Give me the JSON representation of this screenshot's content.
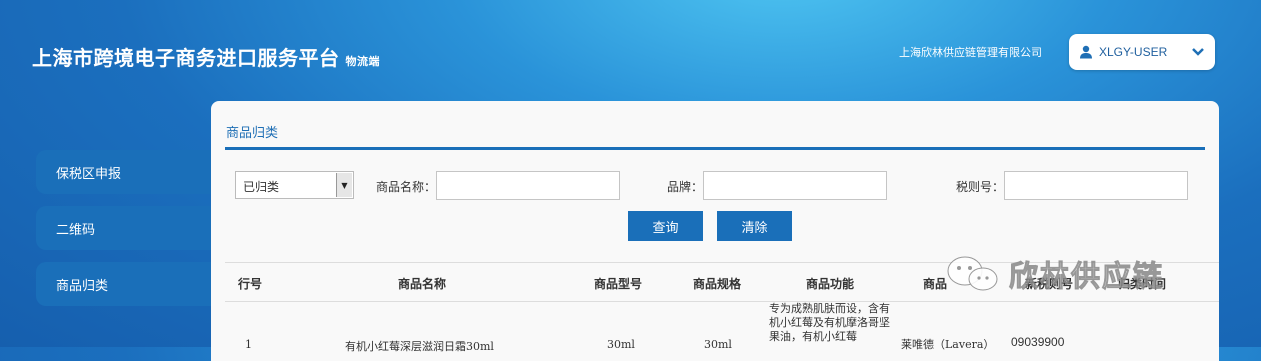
{
  "header": {
    "title": "上海市跨境电子商务进口服务平台",
    "subtitle": "物流端",
    "company": "上海欣林供应链管理有限公司",
    "user": "XLGY-USER",
    "user_icon": "user-icon",
    "dropdown_icon": "chevron-down-icon"
  },
  "sidebar": {
    "items": [
      {
        "label": "保税区申报"
      },
      {
        "label": "二维码"
      },
      {
        "label": "商品归类"
      }
    ]
  },
  "panel": {
    "title": "商品归类",
    "filter": {
      "status_value": "已归类",
      "name_label": "商品名称：",
      "brand_label": "品牌：",
      "tax_label": "税则号：",
      "name_value": "",
      "brand_value": "",
      "tax_value": ""
    },
    "buttons": {
      "search": "查询",
      "clear": "清除"
    },
    "table": {
      "headers": [
        "行号",
        "商品名称",
        "商品型号",
        "商品规格",
        "商品功能",
        "商品",
        "新税则号",
        "归类时间"
      ],
      "rows": [
        {
          "no": "1",
          "name": "有机小红莓深层滋润日霜30ml",
          "model": "30ml",
          "spec": "30ml",
          "function": "专为成熟肌肤而设，含有机小红莓及有机摩洛哥坚果油，有机小红莓",
          "brand": "莱唯德（Lavera）",
          "tax_no": "09039900"
        }
      ]
    }
  },
  "watermark": {
    "text": "欣林供应链",
    "icon": "wechat-icon"
  },
  "colors": {
    "accent": "#1a6fb9",
    "bg_light": "#4fc6f2",
    "bg_dark": "#165fae"
  }
}
